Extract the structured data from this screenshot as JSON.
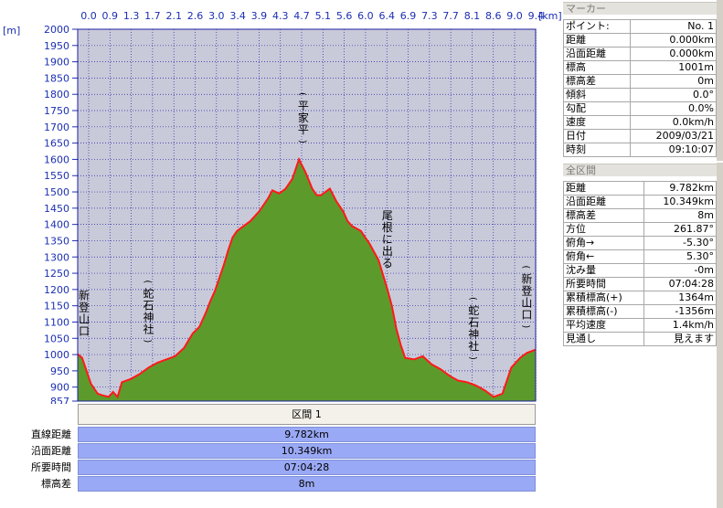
{
  "chart_data": {
    "type": "area",
    "x_unit": "[km]",
    "y_unit": "[m]",
    "x_ticks": [
      "0.0",
      "0.9",
      "1.3",
      "1.7",
      "2.1",
      "2.6",
      "3.0",
      "3.4",
      "3.9",
      "4.3",
      "4.7",
      "5.1",
      "5.6",
      "6.0",
      "6.4",
      "6.9",
      "7.3",
      "7.7",
      "8.1",
      "8.6",
      "9.0",
      "9.4"
    ],
    "y_ticks": [
      "2000",
      "1950",
      "1900",
      "1850",
      "1800",
      "1750",
      "1700",
      "1650",
      "1600",
      "1550",
      "1500",
      "1450",
      "1400",
      "1350",
      "1300",
      "1250",
      "1200",
      "1150",
      "1100",
      "1050",
      "1000",
      "950",
      "900",
      "857"
    ],
    "ylim": [
      857,
      2000
    ],
    "xlim": [
      0,
      10.349
    ],
    "x": [
      0,
      0.1,
      0.2,
      0.3,
      0.45,
      0.55,
      0.7,
      0.8,
      0.9,
      1.0,
      1.2,
      1.4,
      1.6,
      1.8,
      2.0,
      2.2,
      2.4,
      2.6,
      2.75,
      2.9,
      3.0,
      3.1,
      3.2,
      3.3,
      3.4,
      3.5,
      3.6,
      3.7,
      3.9,
      4.1,
      4.3,
      4.4,
      4.55,
      4.7,
      4.85,
      5.0,
      5.15,
      5.3,
      5.4,
      5.5,
      5.7,
      5.85,
      6.0,
      6.1,
      6.2,
      6.4,
      6.6,
      6.8,
      7.0,
      7.1,
      7.2,
      7.3,
      7.4,
      7.6,
      7.8,
      8.0,
      8.2,
      8.4,
      8.6,
      8.8,
      9.0,
      9.2,
      9.4,
      9.6,
      9.8,
      10.0,
      10.15,
      10.349
    ],
    "y": [
      1001,
      990,
      950,
      910,
      880,
      875,
      870,
      885,
      870,
      915,
      925,
      940,
      960,
      975,
      985,
      995,
      1020,
      1065,
      1085,
      1130,
      1165,
      1195,
      1235,
      1275,
      1320,
      1360,
      1380,
      1390,
      1410,
      1440,
      1480,
      1505,
      1495,
      1510,
      1540,
      1600,
      1560,
      1510,
      1490,
      1490,
      1510,
      1470,
      1440,
      1410,
      1395,
      1380,
      1340,
      1290,
      1200,
      1150,
      1080,
      1030,
      990,
      985,
      995,
      970,
      955,
      935,
      920,
      915,
      905,
      890,
      870,
      880,
      960,
      990,
      1005,
      1015
    ],
    "annotations": [
      {
        "label": "新登山口",
        "x": 0.1
      },
      {
        "label": "(蛇石神社)",
        "x": 1.6
      },
      {
        "label": "(平家平)",
        "x": 5.1
      },
      {
        "label": "尾根に出る",
        "x": 7.0
      },
      {
        "label": "(蛇石神社)",
        "x": 8.95
      },
      {
        "label": "(新登山口)",
        "x": 10.15
      }
    ],
    "line_color": "#ff1a1a",
    "fill_color": "#5d9a2c",
    "plot_bg": "#c9cad9",
    "grid": true
  },
  "marker_panel": {
    "title": "マーカー",
    "rows": [
      {
        "k": "ポイント:",
        "v": "No. 1"
      },
      {
        "k": "距離",
        "v": "0.000km"
      },
      {
        "k": "沿面距離",
        "v": "0.000km"
      },
      {
        "k": "標高",
        "v": "1001m"
      },
      {
        "k": "標高差",
        "v": "0m"
      },
      {
        "k": "傾斜",
        "v": "0.0°"
      },
      {
        "k": "勾配",
        "v": "0.0%"
      },
      {
        "k": "速度",
        "v": "0.0km/h"
      },
      {
        "k": "日付",
        "v": "2009/03/21"
      },
      {
        "k": "時刻",
        "v": "09:10:07"
      }
    ]
  },
  "section_panel": {
    "title": "全区間",
    "rows": [
      {
        "k": "距離",
        "v": "9.782km"
      },
      {
        "k": "沿面距離",
        "v": "10.349km"
      },
      {
        "k": "標高差",
        "v": "8m"
      },
      {
        "k": "方位",
        "v": "261.87°"
      },
      {
        "k": "俯角→",
        "v": "-5.30°"
      },
      {
        "k": "俯角←",
        "v": "5.30°"
      },
      {
        "k": "沈み量",
        "v": "-0m"
      },
      {
        "k": "所要時間",
        "v": "07:04:28"
      },
      {
        "k": "累積標高(+)",
        "v": "1364m"
      },
      {
        "k": "累積標高(-)",
        "v": "-1356m"
      },
      {
        "k": "平均速度",
        "v": "1.4km/h"
      },
      {
        "k": "見通し",
        "v": "見えます"
      }
    ]
  },
  "bottom": {
    "section_label": "区間 1",
    "rows": [
      {
        "label": "直線距離",
        "value": "9.782km"
      },
      {
        "label": "沿面距離",
        "value": "10.349km"
      },
      {
        "label": "所要時間",
        "value": "07:04:28"
      },
      {
        "label": "標高差",
        "value": "8m"
      }
    ]
  }
}
